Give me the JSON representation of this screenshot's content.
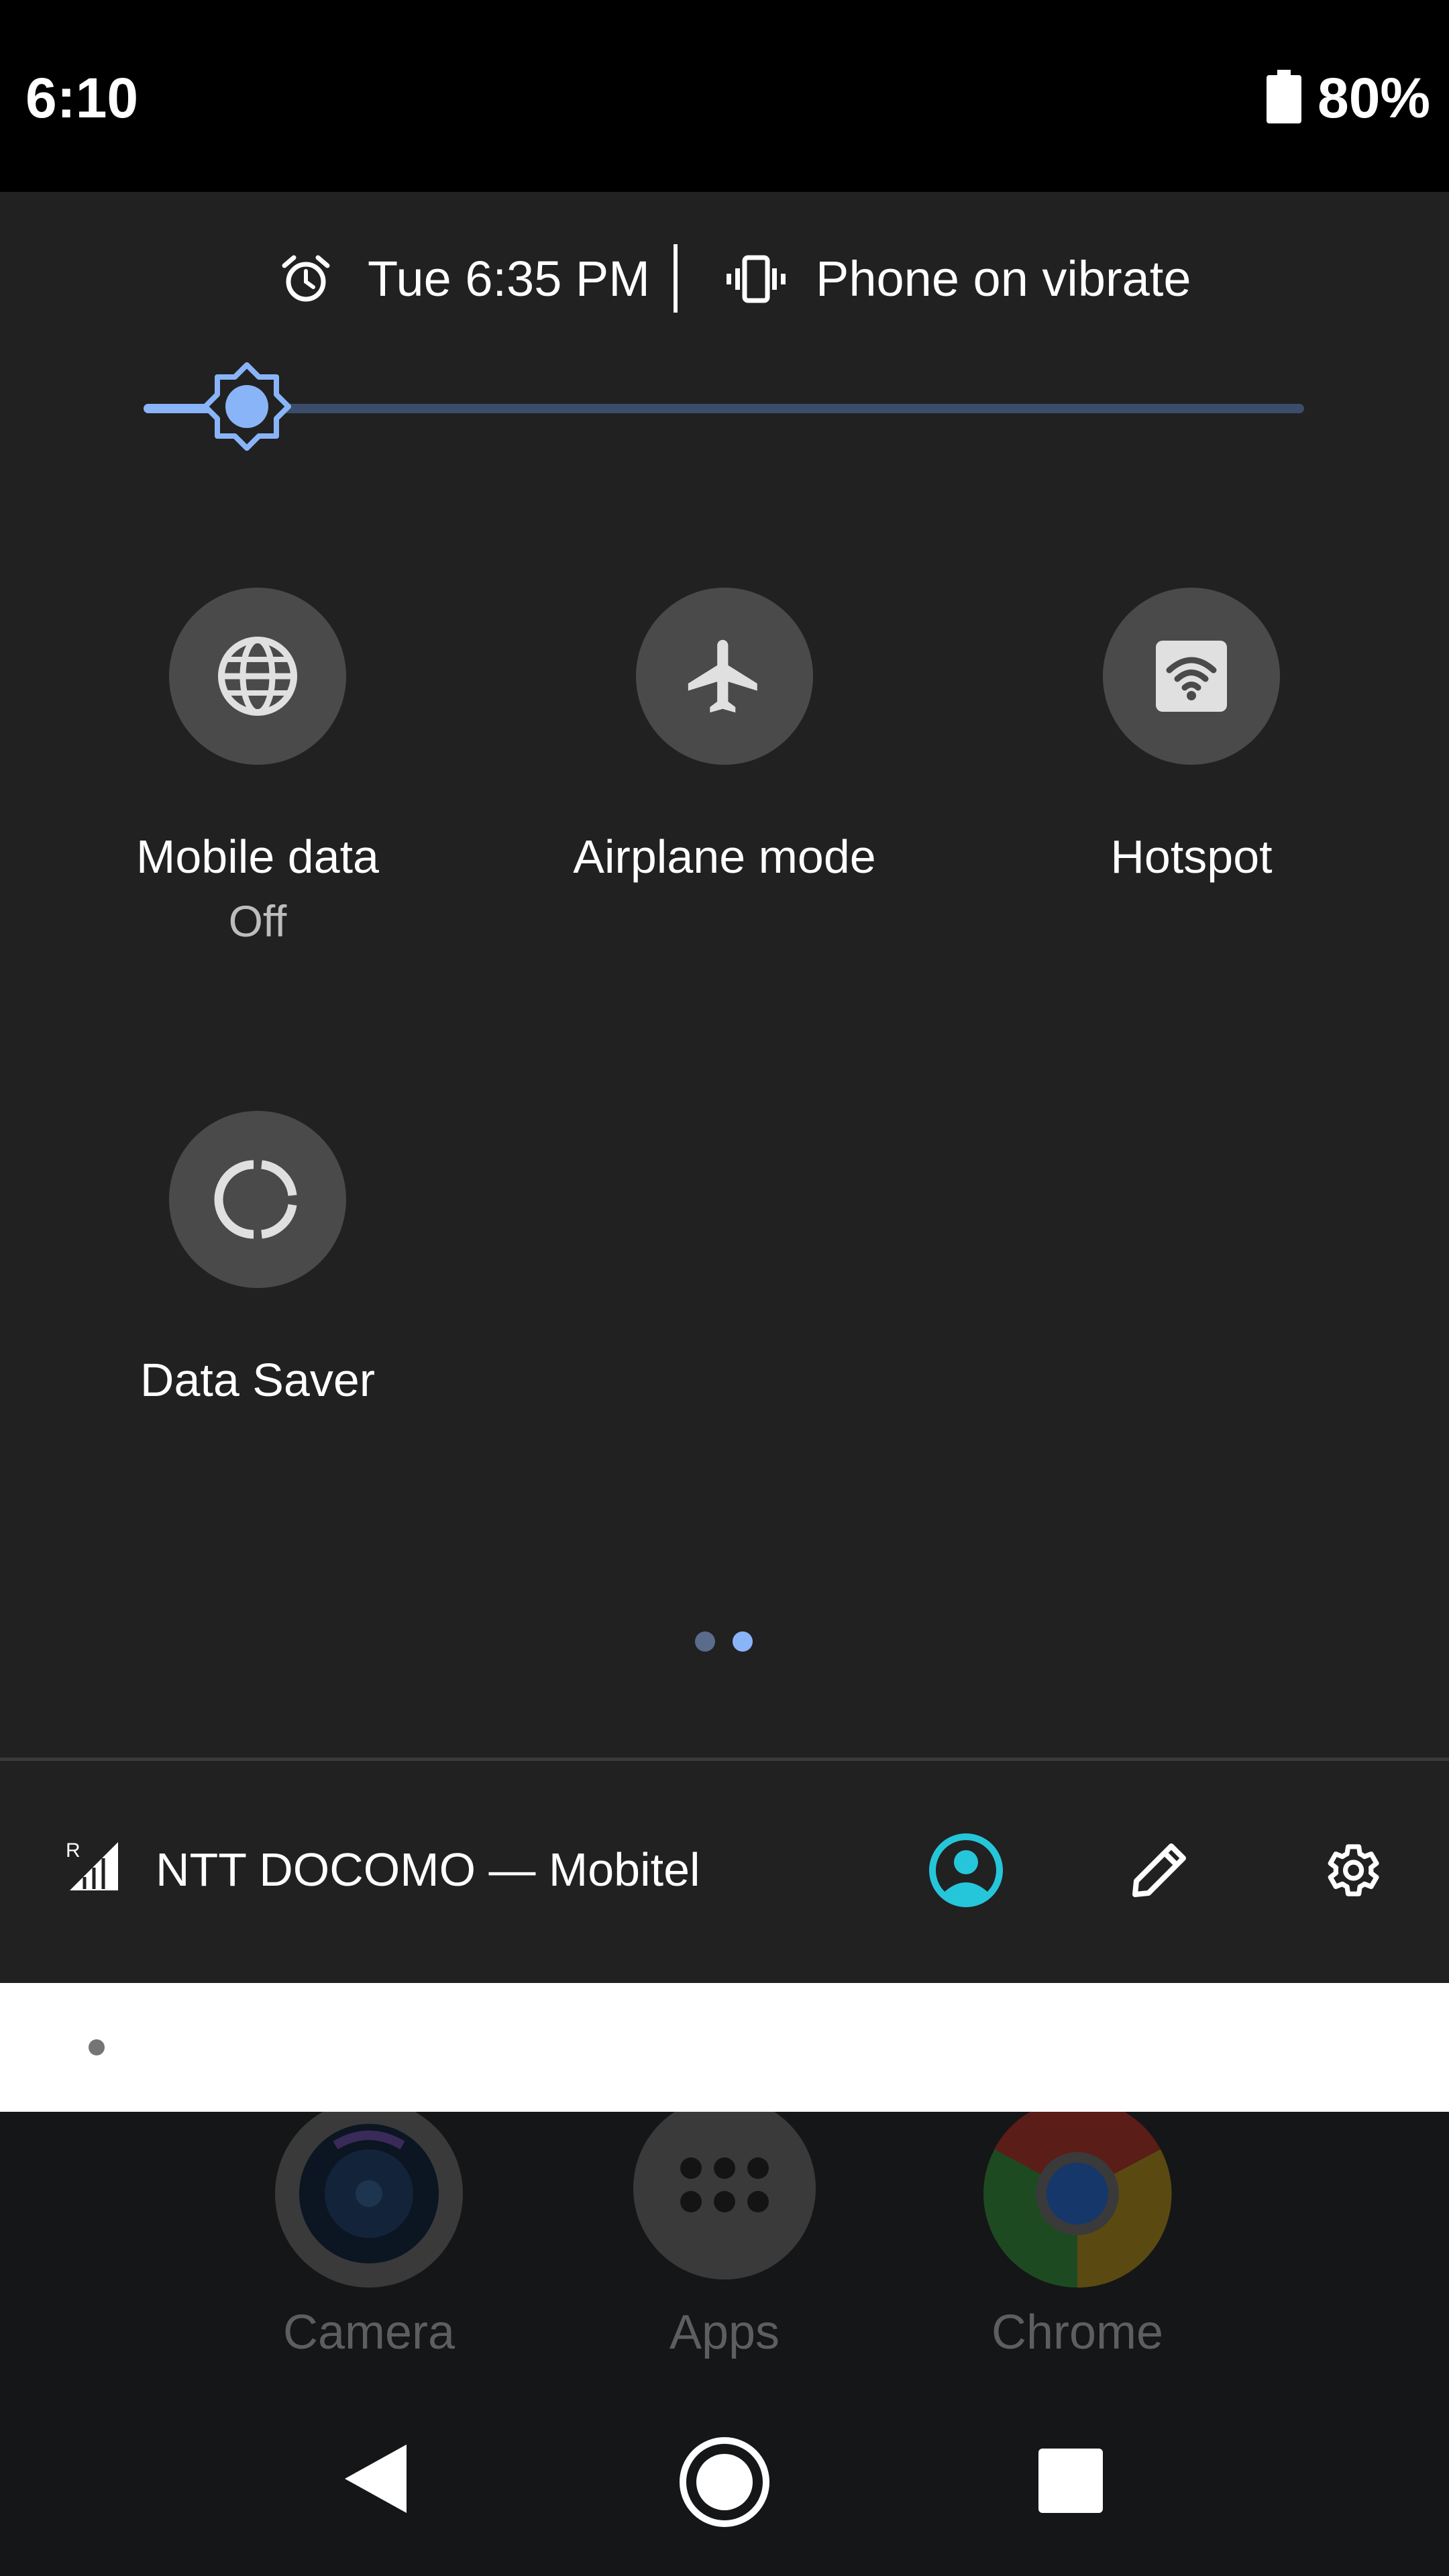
{
  "status_bar": {
    "time": "6:10",
    "battery": "80%"
  },
  "header": {
    "alarm": "Tue 6:35 PM",
    "ringer": "Phone on vibrate"
  },
  "brightness": {
    "level": 0.08
  },
  "tiles": [
    {
      "label": "Mobile data",
      "sublabel": "Off",
      "icon": "globe-icon"
    },
    {
      "label": "Airplane mode",
      "sublabel": "",
      "icon": "airplane-icon"
    },
    {
      "label": "Hotspot",
      "sublabel": "",
      "icon": "hotspot-icon"
    },
    {
      "label": "Data Saver",
      "sublabel": "",
      "icon": "data-saver-icon"
    }
  ],
  "pages": {
    "count": 2,
    "active": 2
  },
  "footer": {
    "carrier": "NTT DOCOMO — Mobitel",
    "roaming_indicator": "R"
  },
  "dock": {
    "apps": [
      {
        "label": "Camera",
        "icon": "camera-icon"
      },
      {
        "label": "Apps",
        "icon": "apps-icon"
      },
      {
        "label": "Chrome",
        "icon": "chrome-icon"
      }
    ]
  },
  "colors": {
    "accent": "#8ab4f8",
    "user_icon": "#26c6da",
    "panel_bg": "#212121",
    "tile_bg": "#4a4a4a"
  }
}
